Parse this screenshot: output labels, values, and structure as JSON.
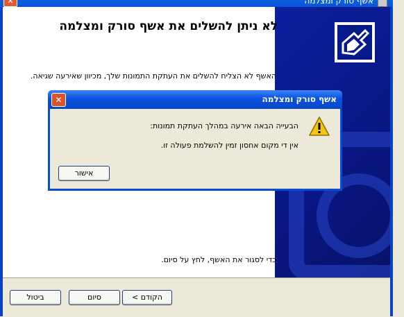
{
  "window": {
    "title": "אשף סורק ומצלמה",
    "close_glyph": "✕",
    "icon": "camera-wizard-icon"
  },
  "wizard": {
    "heading": "לא ניתן להשלים את אשף סורק ומצלמה",
    "body_text": "האשף לא הצליח להשלים את העתקת התמונות שלך, מכיוון שאירעה שגיאה.",
    "close_hint": "כדי לסגור את האשף, לחץ על סיום.",
    "buttons": {
      "back": "< הקודם",
      "finish": "סיום",
      "cancel": "ביטול"
    }
  },
  "dialog": {
    "title": "אשף סורק ומצלמה",
    "close_glyph": "✕",
    "icon": "warning-icon",
    "line1": "הבעייה הבאה אירעה במהלך העתקת תמונות:",
    "line2": "אין די מקום אחסון זמין להשלמת פעולה זו.",
    "ok_label": "אישור"
  },
  "colors": {
    "titlebar_blue": "#0a52df",
    "banner_blue": "#0a1785",
    "close_red": "#d9532c",
    "face": "#ece9d8"
  }
}
